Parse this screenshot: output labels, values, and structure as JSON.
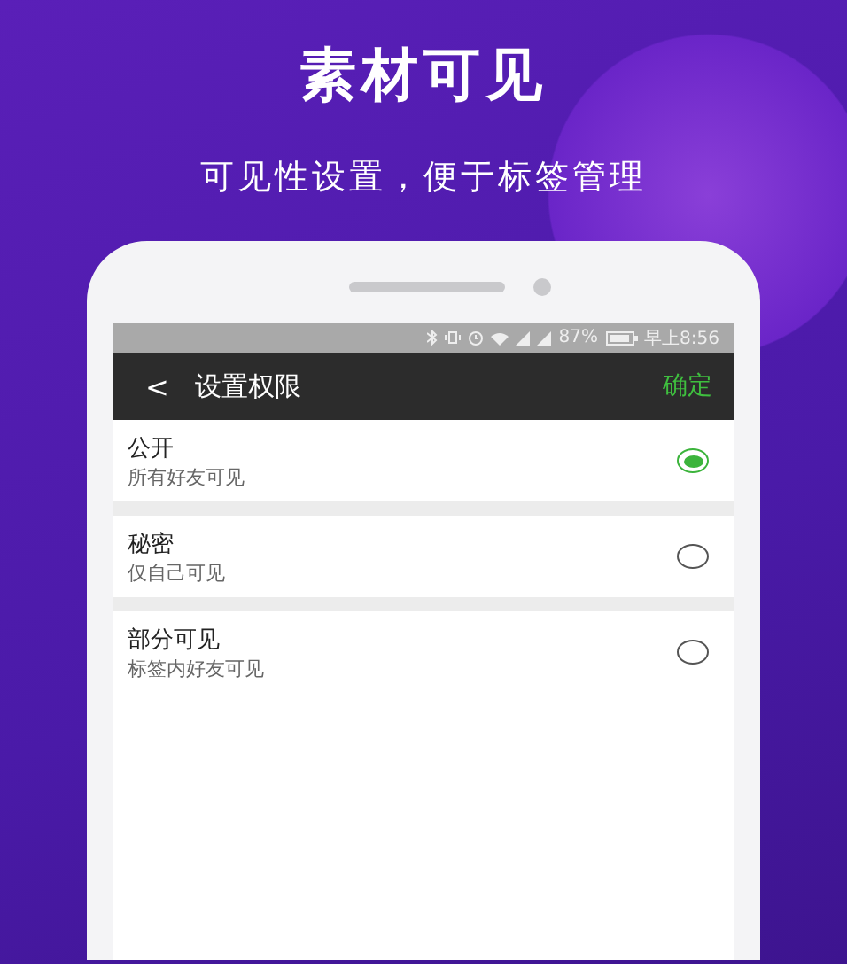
{
  "headline": "素材可见",
  "subtitle": "可见性设置，便于标签管理",
  "status_bar": {
    "battery": "87%",
    "time": "早上8:56"
  },
  "nav_bar": {
    "back": "<",
    "title": "设置权限",
    "action": "确定"
  },
  "options": [
    {
      "title": "公开",
      "description": "所有好友可见",
      "selected": true
    },
    {
      "title": "秘密",
      "description": "仅自己可见",
      "selected": false
    },
    {
      "title": "部分可见",
      "description": "标签内好友可见",
      "selected": false
    }
  ]
}
